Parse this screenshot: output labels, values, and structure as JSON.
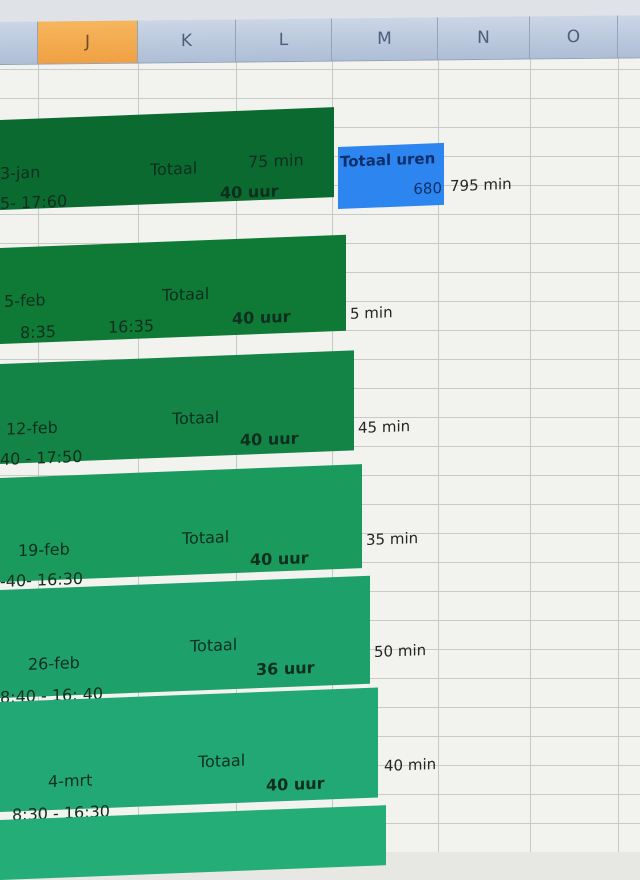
{
  "columns": [
    "J",
    "K",
    "L",
    "M",
    "N",
    "O"
  ],
  "selected_column": "J",
  "colors": {
    "band1": "#0b6a2f",
    "band2": "#0e7a36",
    "band3": "#138446",
    "band4": "#1a9a5c",
    "band5": "#1da06a",
    "band6": "#22a874",
    "header": "#b9c6da",
    "selected_header": "#f3a84c",
    "totals_cell": "#2d86f0"
  },
  "weeks": [
    {
      "date": "3-jan",
      "time": "5- 17:60",
      "total_label": "Totaal",
      "minutes": "75 min",
      "hours": "40 uur"
    },
    {
      "date": "5-feb",
      "time_start": "8:35",
      "time_end": "16:35",
      "total_label": "Totaal",
      "hours": "40 uur",
      "side": "5 min"
    },
    {
      "date": "12-feb",
      "time": "40 - 17:50",
      "total_label": "Totaal",
      "hours": "40 uur",
      "side": "45 min"
    },
    {
      "date": "19-feb",
      "time": "-40- 16:30",
      "total_label": "Totaal",
      "hours": "40 uur",
      "side": "35 min"
    },
    {
      "date": "26-feb",
      "time": "8:40 - 16: 40",
      "total_label": "Totaal",
      "hours": "36 uur",
      "side": "50 min"
    },
    {
      "date": "4-mrt",
      "time": "8:30 - 16:30",
      "total_label": "Totaal",
      "hours": "40 uur",
      "side": "40 min"
    }
  ],
  "totals": {
    "label": "Totaal uren",
    "value": "680",
    "minutes": "795 min"
  }
}
